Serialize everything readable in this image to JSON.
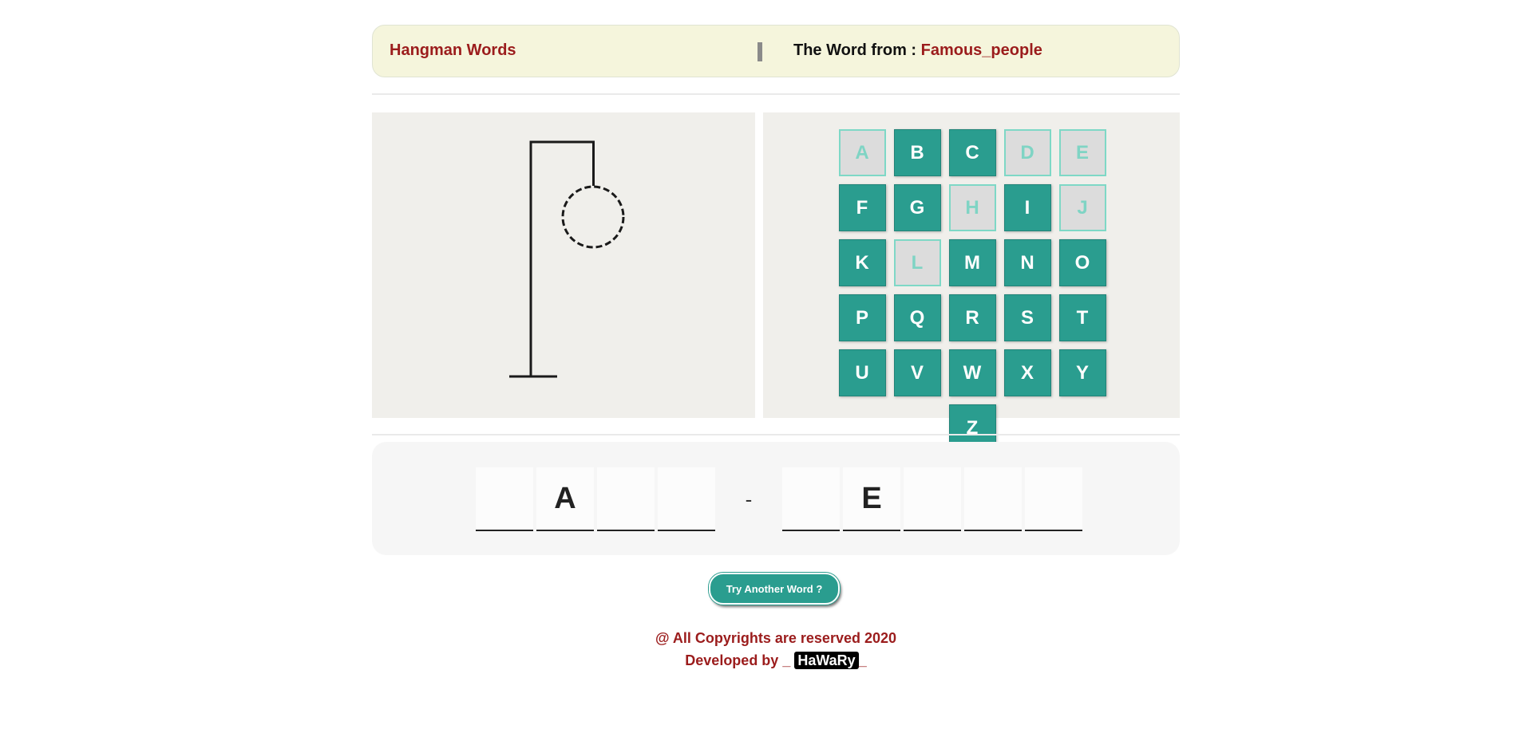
{
  "header": {
    "title": "Hangman Words",
    "category_label": "The Word from : ",
    "category_value": "Famous_people"
  },
  "letters": [
    {
      "letter": "A",
      "used": true
    },
    {
      "letter": "B",
      "used": false
    },
    {
      "letter": "C",
      "used": false
    },
    {
      "letter": "D",
      "used": true
    },
    {
      "letter": "E",
      "used": true
    },
    {
      "letter": "F",
      "used": false
    },
    {
      "letter": "G",
      "used": false
    },
    {
      "letter": "H",
      "used": true
    },
    {
      "letter": "I",
      "used": false
    },
    {
      "letter": "J",
      "used": true
    },
    {
      "letter": "K",
      "used": false
    },
    {
      "letter": "L",
      "used": true
    },
    {
      "letter": "M",
      "used": false
    },
    {
      "letter": "N",
      "used": false
    },
    {
      "letter": "O",
      "used": false
    },
    {
      "letter": "P",
      "used": false
    },
    {
      "letter": "Q",
      "used": false
    },
    {
      "letter": "R",
      "used": false
    },
    {
      "letter": "S",
      "used": false
    },
    {
      "letter": "T",
      "used": false
    },
    {
      "letter": "U",
      "used": false
    },
    {
      "letter": "V",
      "used": false
    },
    {
      "letter": "W",
      "used": false
    },
    {
      "letter": "X",
      "used": false
    },
    {
      "letter": "Y",
      "used": false
    },
    {
      "letter": "Z",
      "used": false
    }
  ],
  "word": {
    "slots": [
      "",
      "A",
      "",
      "",
      "-",
      "",
      "E",
      "",
      "",
      ""
    ]
  },
  "try_button": "Try Another Word ?",
  "footer": {
    "copyright": "@ All Copyrights are reserved 2020",
    "developed_prefix": "Developed by _ ",
    "developer": "HaWaRy",
    "developed_suffix": "_"
  },
  "colors": {
    "accent": "#2a9d8f",
    "brand_red": "#9b1c1c",
    "header_bg": "#f5f5dc"
  },
  "hangman": {
    "wrong_guesses": 1,
    "head_style": "dashed"
  }
}
